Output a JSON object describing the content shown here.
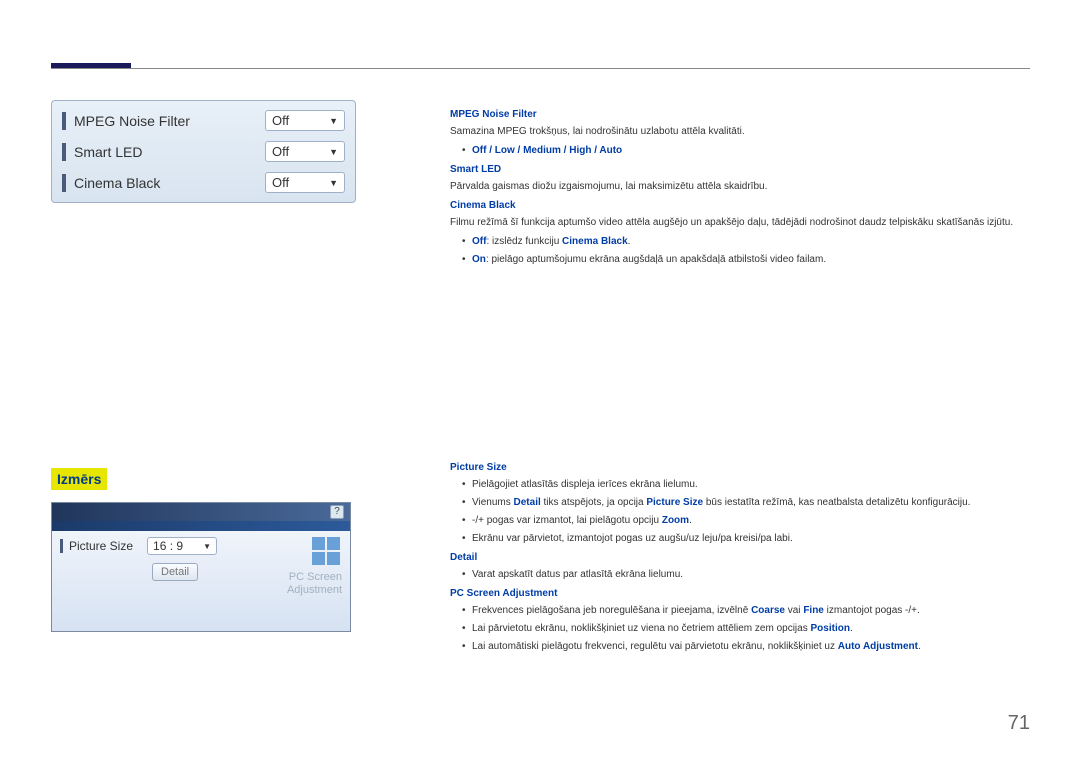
{
  "page_number": "71",
  "menu1": {
    "items": [
      {
        "label": "MPEG Noise Filter",
        "value": "Off"
      },
      {
        "label": "Smart LED",
        "value": "Off"
      },
      {
        "label": "Cinema Black",
        "value": "Off"
      }
    ]
  },
  "section2_title": "Izmērs",
  "ss2": {
    "help": "?",
    "row_label": "Picture Size",
    "row_value": "16 : 9",
    "detail_btn": "Detail",
    "pc_label_line1": "PC Screen",
    "pc_label_line2": "Adjustment"
  },
  "doc": {
    "h1": "MPEG Noise Filter",
    "p1": "Samazina MPEG trokšņus, lai nodrošinātu uzlabotu attēla kvalitāti.",
    "b1": "Off / Low / Medium / High / Auto",
    "h2": "Smart LED",
    "p2": "Pārvalda gaismas diožu izgaismojumu, lai maksimizētu attēla skaidrību.",
    "h3": "Cinema Black",
    "p3": "Filmu režīmā šī funkcija aptumšo video attēla augšējo un apakšējo daļu, tādējādi nodrošinot daudz telpiskāku skatīšanās izjūtu.",
    "b3a_pre": "Off",
    "b3a_mid": ": izslēdz funkciju ",
    "b3a_post": "Cinema Black",
    "b3a_end": ".",
    "b3b_pre": "On",
    "b3b_post": ": pielāgo aptumšojumu ekrāna augšdaļā un apakšdaļā atbilstoši video failam.",
    "h4": "Picture Size",
    "b4a": "Pielāgojiet atlasītās displeja ierīces ekrāna lielumu.",
    "b4b_1": "Vienums ",
    "b4b_k1": "Detail",
    "b4b_2": " tiks atspējots, ja opcija ",
    "b4b_k2": "Picture Size",
    "b4b_3": " būs iestatīta režīmā, kas neatbalsta detalizētu konfigurāciju.",
    "b4c_1": "-/+ pogas var izmantot, lai pielāgotu opciju ",
    "b4c_k": "Zoom",
    "b4c_2": ".",
    "b4d": "Ekrānu var pārvietot, izmantojot pogas uz augšu/uz leju/pa kreisi/pa labi.",
    "h5": "Detail",
    "b5a": "Varat apskatīt datus par atlasītā ekrāna lielumu.",
    "h6": "PC Screen Adjustment",
    "b6a_1": "Frekvences pielāgošana jeb noregulēšana ir pieejama, izvēlnē ",
    "b6a_k1": "Coarse",
    "b6a_2": " vai ",
    "b6a_k2": "Fine",
    "b6a_3": " izmantojot pogas -/+.",
    "b6b_1": "Lai pārvietotu ekrānu, noklikšķiniet uz viena no četriem attēliem zem opcijas ",
    "b6b_k": "Position",
    "b6b_2": ".",
    "b6c_1": "Lai automātiski pielāgotu frekvenci, regulētu vai pārvietotu ekrānu, noklikšķiniet uz ",
    "b6c_k": "Auto Adjustment",
    "b6c_2": "."
  }
}
